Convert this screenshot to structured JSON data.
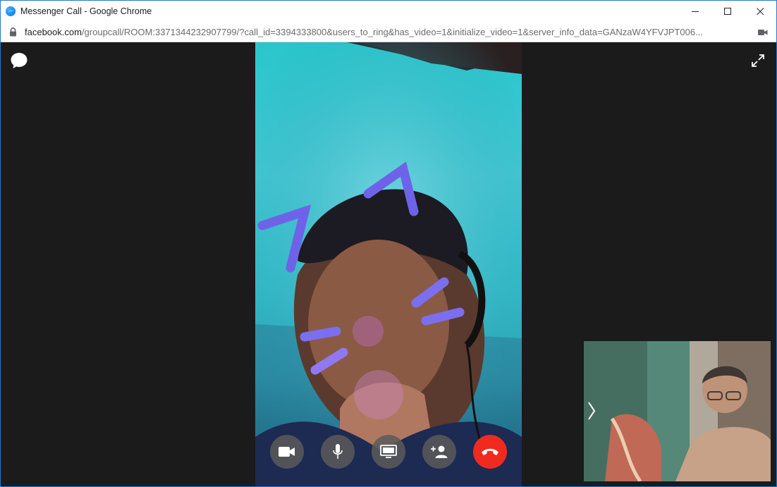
{
  "window": {
    "title": "Messenger Call - Google Chrome"
  },
  "address": {
    "host": "facebook.com",
    "path": "/groupcall/ROOM:3371344232907799/?call_id=3394333800&users_to_ring&has_video=1&initialize_video=1&server_info_data=GANzaW4YFVJPT006..."
  },
  "icons": {
    "app": "messenger-icon",
    "lock": "lock-icon",
    "camera_in_use": "video-camera-icon",
    "chat": "chat-bubble-icon",
    "fullscreen": "expand-icon",
    "self_view_toggle": "chevron-right-icon"
  },
  "controls": [
    {
      "name": "camera-toggle-button",
      "icon": "video-camera-icon"
    },
    {
      "name": "microphone-toggle-button",
      "icon": "microphone-icon"
    },
    {
      "name": "screen-share-button",
      "icon": "monitor-icon"
    },
    {
      "name": "add-person-button",
      "icon": "add-person-icon"
    },
    {
      "name": "end-call-button",
      "icon": "phone-hangup-icon"
    }
  ],
  "colors": {
    "end_call": "#f02a1f",
    "control_bg": "#5a5a5a",
    "stage_bg": "#1b1b1b",
    "window_border": "#2b76d2"
  }
}
